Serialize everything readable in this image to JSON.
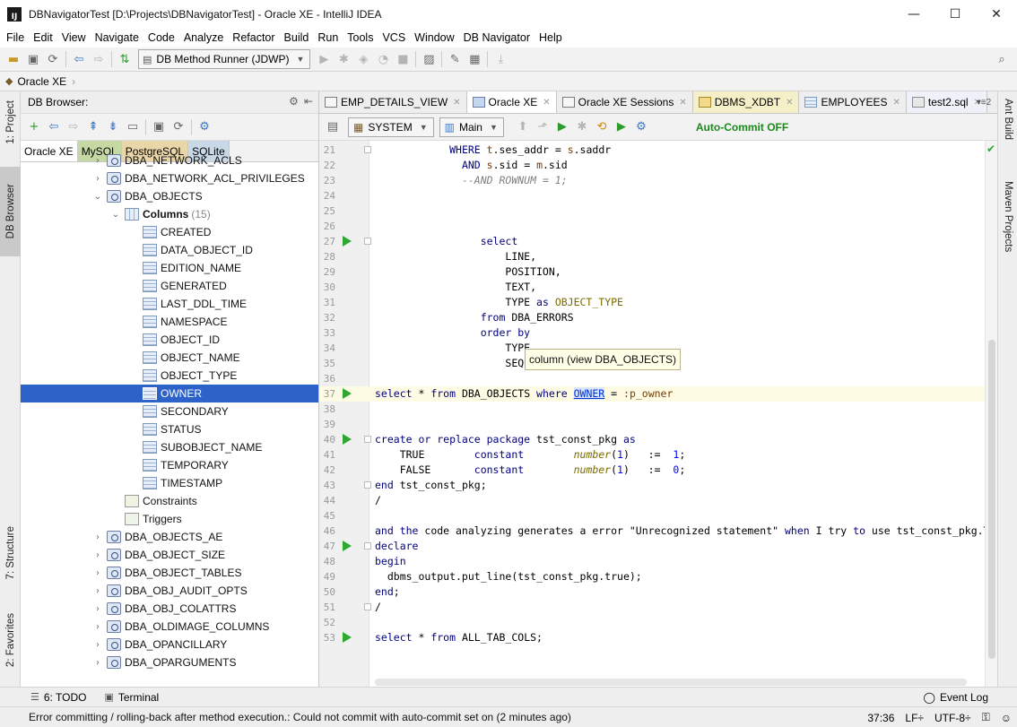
{
  "window": {
    "title": "DBNavigatorTest [D:\\Projects\\DBNavigatorTest] - Oracle XE - IntelliJ IDEA",
    "app_icon_text": "IJ"
  },
  "menu": [
    "File",
    "Edit",
    "View",
    "Navigate",
    "Code",
    "Analyze",
    "Refactor",
    "Build",
    "Run",
    "Tools",
    "VCS",
    "Window",
    "DB Navigator",
    "Help"
  ],
  "toolbar": {
    "runner_label": "DB Method Runner (JDWP)"
  },
  "navbar": {
    "crumb": "Oracle XE"
  },
  "left_tool_tabs": {
    "project": "1: Project",
    "db_browser": "DB Browser",
    "structure": "7: Structure",
    "favorites": "2: Favorites"
  },
  "right_tool_tabs": {
    "ant": "Ant Build",
    "maven": "Maven Projects"
  },
  "browser": {
    "title": "DB Browser:",
    "connections": [
      "Oracle XE",
      "MySQL",
      "PostgreSQL",
      "SQLite"
    ],
    "tree": [
      {
        "label": "DBA_NETWORK_ACLS",
        "icon": "view",
        "level": 0,
        "arrow": "›"
      },
      {
        "label": "DBA_NETWORK_ACL_PRIVILEGES",
        "icon": "view",
        "level": 0,
        "arrow": "›"
      },
      {
        "label": "DBA_OBJECTS",
        "icon": "view",
        "level": 0,
        "arrow": "⌄"
      },
      {
        "label": "Columns",
        "icon": "cols",
        "level": 1,
        "arrow": "⌄",
        "bold": true,
        "count": "(15)"
      },
      {
        "label": "CREATED",
        "icon": "col",
        "level": 2
      },
      {
        "label": "DATA_OBJECT_ID",
        "icon": "col",
        "level": 2
      },
      {
        "label": "EDITION_NAME",
        "icon": "col",
        "level": 2
      },
      {
        "label": "GENERATED",
        "icon": "col",
        "level": 2
      },
      {
        "label": "LAST_DDL_TIME",
        "icon": "col",
        "level": 2
      },
      {
        "label": "NAMESPACE",
        "icon": "col",
        "level": 2
      },
      {
        "label": "OBJECT_ID",
        "icon": "col",
        "level": 2
      },
      {
        "label": "OBJECT_NAME",
        "icon": "col",
        "level": 2
      },
      {
        "label": "OBJECT_TYPE",
        "icon": "col",
        "level": 2
      },
      {
        "label": "OWNER",
        "icon": "col",
        "level": 2,
        "selected": true
      },
      {
        "label": "SECONDARY",
        "icon": "col",
        "level": 2
      },
      {
        "label": "STATUS",
        "icon": "col",
        "level": 2
      },
      {
        "label": "SUBOBJECT_NAME",
        "icon": "col",
        "level": 2
      },
      {
        "label": "TEMPORARY",
        "icon": "col",
        "level": 2
      },
      {
        "label": "TIMESTAMP",
        "icon": "col",
        "level": 2
      },
      {
        "label": "Constraints",
        "icon": "cons",
        "level": 1
      },
      {
        "label": "Triggers",
        "icon": "trig",
        "level": 1
      },
      {
        "label": "DBA_OBJECTS_AE",
        "icon": "view",
        "level": 0,
        "arrow": "›"
      },
      {
        "label": "DBA_OBJECT_SIZE",
        "icon": "view",
        "level": 0,
        "arrow": "›"
      },
      {
        "label": "DBA_OBJECT_TABLES",
        "icon": "view",
        "level": 0,
        "arrow": "›"
      },
      {
        "label": "DBA_OBJ_AUDIT_OPTS",
        "icon": "view",
        "level": 0,
        "arrow": "›"
      },
      {
        "label": "DBA_OBJ_COLATTRS",
        "icon": "view",
        "level": 0,
        "arrow": "›"
      },
      {
        "label": "DBA_OLDIMAGE_COLUMNS",
        "icon": "view",
        "level": 0,
        "arrow": "›"
      },
      {
        "label": "DBA_OPANCILLARY",
        "icon": "view",
        "level": 0,
        "arrow": "›"
      },
      {
        "label": "DBA_OPARGUMENTS",
        "icon": "view",
        "level": 0,
        "arrow": "›"
      }
    ]
  },
  "editor": {
    "tabs": [
      {
        "label": "EMP_DETAILS_VIEW",
        "icon": "console",
        "style": ""
      },
      {
        "label": "Oracle XE",
        "icon": "conn",
        "style": "active"
      },
      {
        "label": "Oracle XE Sessions",
        "icon": "console",
        "style": ""
      },
      {
        "label": "DBMS_XDBT",
        "icon": "pkg",
        "style": "yellow"
      },
      {
        "label": "EMPLOYEES",
        "icon": "tbl",
        "style": ""
      },
      {
        "label": "test2.sql",
        "icon": "sqlf",
        "style": "sql"
      }
    ],
    "more_tabs": "▾≡2",
    "schema": "SYSTEM",
    "session": "Main",
    "autocommit": "Auto-Commit OFF",
    "tooltip": "column (view DBA_OBJECTS)",
    "lines": [
      {
        "n": "21",
        "code": "            <span class='kw'>WHERE</span> <span class='alias'>t</span>.ses_addr = <span class='alias'>s</span>.saddr",
        "fold": true
      },
      {
        "n": "22",
        "code": "              <span class='kw'>AND</span> <span class='alias'>s</span>.sid = <span class='alias'>m</span>.sid"
      },
      {
        "n": "23",
        "code": "              <span class='cmt'>--AND ROWNUM = 1;</span>"
      },
      {
        "n": "24",
        "code": ""
      },
      {
        "n": "25",
        "code": ""
      },
      {
        "n": "26",
        "code": ""
      },
      {
        "n": "27",
        "code": "                 <span class='kw'>select</span>",
        "run": true,
        "fold": true
      },
      {
        "n": "28",
        "code": "                     LINE,"
      },
      {
        "n": "29",
        "code": "                     POSITION,"
      },
      {
        "n": "30",
        "code": "                     TEXT,"
      },
      {
        "n": "31",
        "code": "                     TYPE <span class='kw'>as</span> <span class='fn' style='font-style:normal'>OBJECT_TYPE</span>"
      },
      {
        "n": "32",
        "code": "                 <span class='kw'>from</span> DBA_ERRORS"
      },
      {
        "n": "33",
        "code": "                 <span class='kw'>order by</span>"
      },
      {
        "n": "34",
        "code": "                     TYPE,"
      },
      {
        "n": "35",
        "code": "                     SEQUENCE"
      },
      {
        "n": "36",
        "code": ""
      },
      {
        "n": "37",
        "code": "<span class='kw'>select</span> * <span class='kw'>from</span> DBA_OBJECTS <span class='kw'>where</span> <span class='ident-link'>OWNER</span> = <span class='bind'>:p_owner</span>",
        "run": true,
        "caret": true
      },
      {
        "n": "38",
        "code": ""
      },
      {
        "n": "39",
        "code": ""
      },
      {
        "n": "40",
        "code": "<span class='kw'>create or replace package</span> tst_const_pkg <span class='kw'>as</span>",
        "run": true,
        "fold": true
      },
      {
        "n": "41",
        "code": "    TRUE        <span class='kw'>constant</span>        <span class='fn'>number</span>(<span class='num'>1</span>)   :=  <span class='num'>1</span>;"
      },
      {
        "n": "42",
        "code": "    FALSE       <span class='kw'>constant</span>        <span class='fn'>number</span>(<span class='num'>1</span>)   :=  <span class='num'>0</span>;"
      },
      {
        "n": "43",
        "code": "<span class='kw'>end</span> tst_const_pkg;",
        "fold": true
      },
      {
        "n": "44",
        "code": "/"
      },
      {
        "n": "45",
        "code": ""
      },
      {
        "n": "46",
        "code": "<span class='kw'>and the</span> code analyzing generates a error \"Unrecognized statement\" <span class='kw'>when</span> I try <span class='kw'>to</span> use tst_const_pkg.T"
      },
      {
        "n": "47",
        "code": "<span class='kw'>declare</span>",
        "run": true,
        "fold": true
      },
      {
        "n": "48",
        "code": "<span class='kw'>begin</span>"
      },
      {
        "n": "49",
        "code": "  dbms_output.put_line(tst_const_pkg.true);"
      },
      {
        "n": "50",
        "code": "<span class='kw'>end</span>;"
      },
      {
        "n": "51",
        "code": "/",
        "fold": true
      },
      {
        "n": "52",
        "code": ""
      },
      {
        "n": "53",
        "code": "<span class='kw'>select</span> * <span class='kw'>from</span> ALL_TAB_COLS;",
        "run": true
      }
    ]
  },
  "bottom": {
    "todo": "6: TODO",
    "terminal": "Terminal",
    "eventlog": "Event Log"
  },
  "status": {
    "message": "Error committing / rolling-back after method execution.: Could not commit with auto-commit set on (2 minutes ago)",
    "position": "37:36",
    "line_sep": "LF÷",
    "encoding": "UTF-8÷"
  }
}
